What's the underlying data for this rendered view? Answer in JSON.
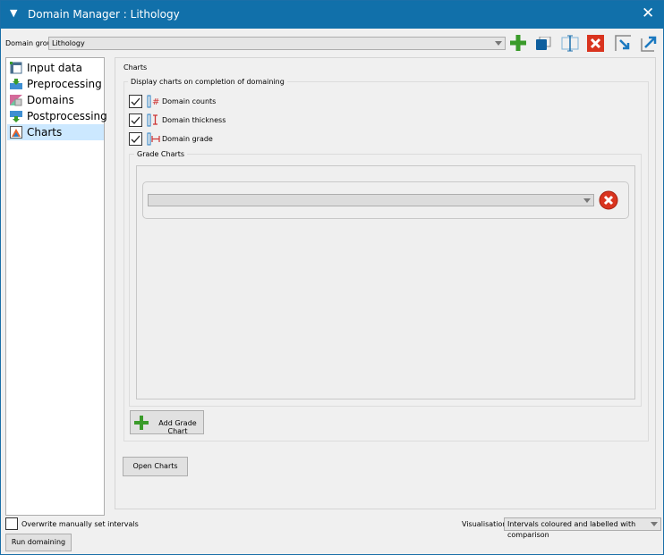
{
  "window": {
    "title": "Domain Manager : Lithology",
    "close": "✕"
  },
  "domain_group": {
    "label": "Domain group",
    "value": "Lithology"
  },
  "toolbar": {
    "icons": [
      "add-icon",
      "copy-icon",
      "split-icon",
      "delete-icon",
      "dock-icon",
      "undock-icon"
    ]
  },
  "sidebar": {
    "items": [
      {
        "label": "Input data"
      },
      {
        "label": "Preprocessing"
      },
      {
        "label": "Domains"
      },
      {
        "label": "Postprocessing"
      },
      {
        "label": "Charts",
        "selected": true
      }
    ]
  },
  "main": {
    "title": "Charts",
    "display_group": {
      "label": "Display charts on completion of domaining",
      "items": [
        {
          "label": "Domain counts",
          "checked": true
        },
        {
          "label": "Domain thickness",
          "checked": true
        },
        {
          "label": "Domain grade",
          "checked": true
        }
      ]
    },
    "grade_charts": {
      "label": "Grade Charts",
      "rows": [
        {
          "value": ""
        }
      ],
      "add_label": "Add Grade Chart"
    },
    "open_charts": "Open Charts"
  },
  "footer": {
    "overwrite_label": "Overwrite manually set intervals",
    "overwrite_checked": false,
    "visualisation_label": "Visualisation",
    "visualisation_value": "Intervals coloured and labelled with comparison",
    "run_label": "Run domaining"
  },
  "colors": {
    "titlebar": "#1170aa",
    "selection": "#cce8ff",
    "add": "#3a9b2a",
    "delete": "#d9341f"
  }
}
